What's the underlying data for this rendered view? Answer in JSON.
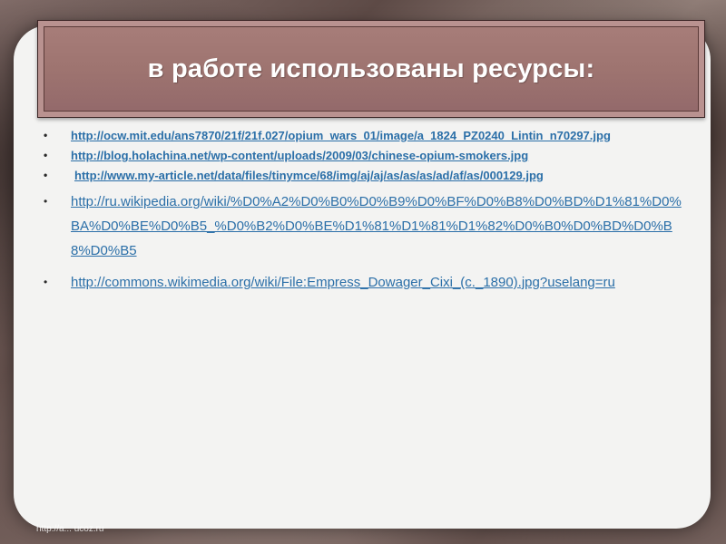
{
  "slide": {
    "title": "в работе использованы ресурсы:",
    "links": [
      "http://ocw.mit.edu/ans7870/21f/21f.027/opium_wars_01/image/a_1824_PZ0240_Lintin_n70297.jpg",
      "http://blog.holachina.net/wp-content/uploads/2009/03/chinese-opium-smokers.jpg",
      "http://www.my-article.net/data/files/tinymce/68/img/aj/aj/as/as/as/ad/af/as/000129.jpg",
      "http://ru.wikipedia.org/wiki/%D0%A2%D0%B0%D0%B9%D0%BF%D0%B8%D0%BD%D1%81%D0%BA%D0%BE%D0%B5_%D0%B2%D0%BE%D1%81%D1%81%D1%82%D0%B0%D0%BD%D0%B8%D0%B5",
      "http://commons.wikimedia.org/wiki/File:Empress_Dowager_Cixi_(c._1890).jpg?uselang=ru"
    ],
    "watermark": "http://a... ucoz.ru"
  }
}
